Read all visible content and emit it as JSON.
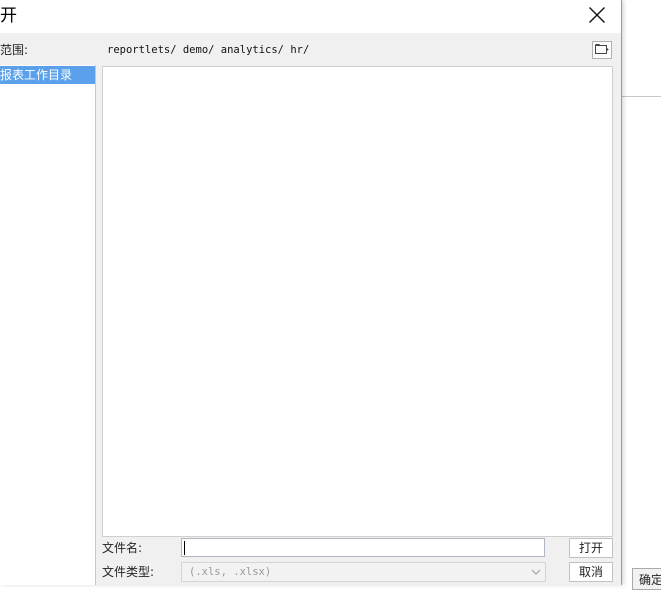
{
  "window": {
    "title": "开",
    "close_icon": "close-icon"
  },
  "left_pane": {
    "scope_label": "范围:",
    "tree_items": [
      {
        "label": "报表工作目录",
        "selected": true
      }
    ]
  },
  "path_bar": {
    "path": "reportlets/ demo/ analytics/ hr/"
  },
  "toolbar": {
    "new_folder_icon": "new-folder-icon"
  },
  "file_list": {
    "items": []
  },
  "footer": {
    "filename_label": "文件名:",
    "filename_value": "",
    "filetype_label": "文件类型:",
    "filetype_value": "(.xls, .xlsx)",
    "open_label": "打开",
    "cancel_label": "取消"
  },
  "background_app": {
    "confirm_label": "确定"
  },
  "colors": {
    "selection": "#5aa0ea",
    "dialog_bg": "#f0f0f0",
    "border": "#c8c8c8"
  }
}
